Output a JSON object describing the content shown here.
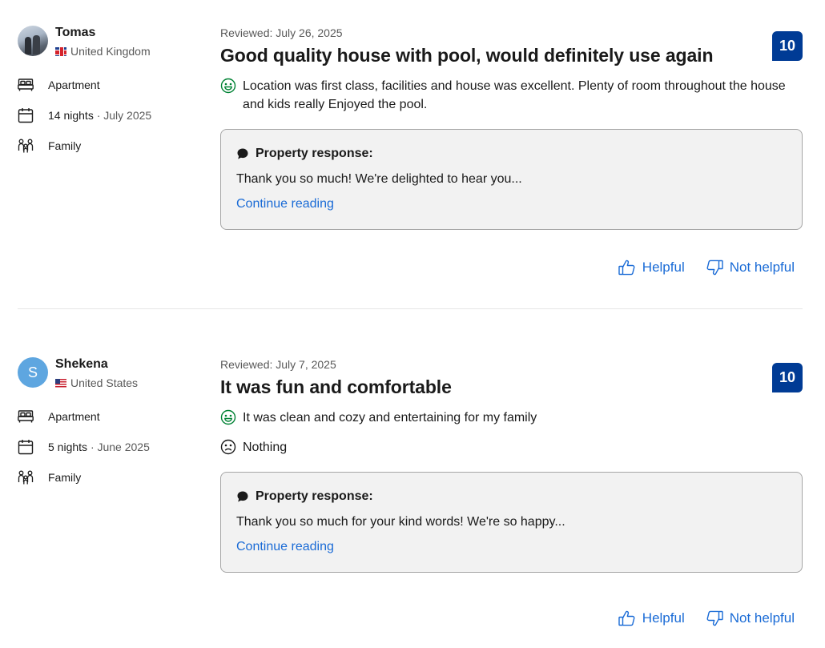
{
  "reviews": [
    {
      "reviewer_name": "Tomas",
      "country": "United Kingdom",
      "room_type": "Apartment",
      "nights": "14 nights",
      "stay_month": "· July 2025",
      "traveler_type": "Family",
      "reviewed_date": "Reviewed: July 26, 2025",
      "title": "Good quality house with pool, would definitely use again",
      "score": "10",
      "positive": "Location was first class, facilities and house was excellent. Plenty of room throughout the house and kids really Enjoyed the pool.",
      "response_label": "Property response:",
      "response_text": "Thank you so much! We're delighted to hear you...",
      "continue_label": "Continue reading",
      "helpful_label": "Helpful",
      "not_helpful_label": "Not helpful"
    },
    {
      "reviewer_name": "Shekena",
      "avatar_initial": "S",
      "country": "United States",
      "room_type": "Apartment",
      "nights": "5 nights",
      "stay_month": "· June 2025",
      "traveler_type": "Family",
      "reviewed_date": "Reviewed: July 7, 2025",
      "title": "It was fun and comfortable",
      "score": "10",
      "positive": "It was clean and cozy and entertaining for my family",
      "negative": "Nothing",
      "response_label": "Property response:",
      "response_text": "Thank you so much for your kind words! We're so happy...",
      "continue_label": "Continue reading",
      "helpful_label": "Helpful",
      "not_helpful_label": "Not helpful"
    }
  ],
  "colors": {
    "score_bg": "#003b95",
    "link": "#1a6bd6",
    "positive_face": "#008234",
    "text": "#1a1a1a",
    "muted": "#595959"
  },
  "icons": [
    "bed-icon",
    "calendar-icon",
    "family-icon",
    "smile-icon",
    "frown-icon",
    "speech-bubble-icon",
    "thumbs-up-icon",
    "thumbs-down-icon"
  ]
}
